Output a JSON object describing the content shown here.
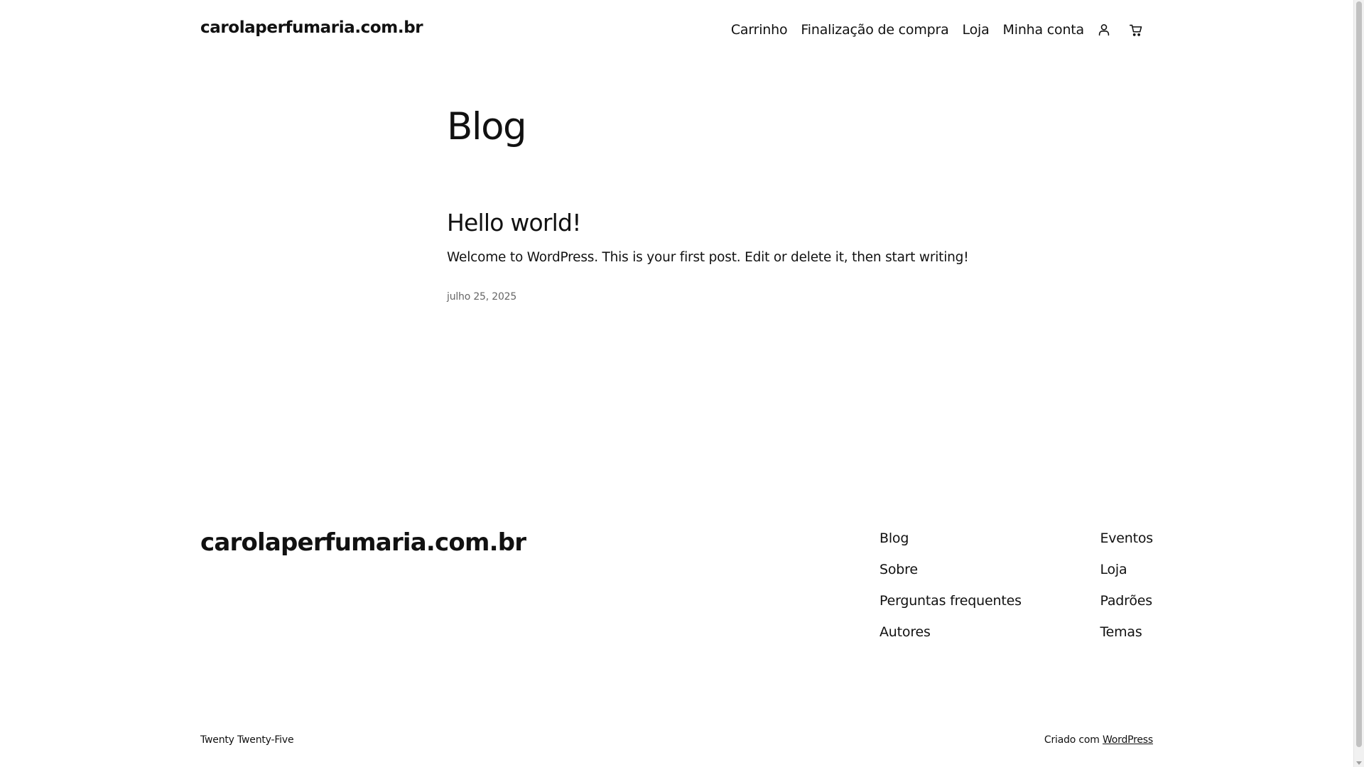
{
  "header": {
    "site_title": "carolaperfumaria.com.br",
    "nav": {
      "cart": "Carrinho",
      "checkout": "Finalização de compra",
      "shop": "Loja",
      "account": "Minha conta"
    },
    "icons": [
      "account-icon",
      "cart-icon"
    ]
  },
  "main": {
    "heading": "Blog",
    "post": {
      "title": "Hello world!",
      "excerpt": "Welcome to WordPress. This is your first post. Edit or delete it, then start writing!",
      "date": "julho 25, 2025"
    }
  },
  "footer": {
    "site_title": "carolaperfumaria.com.br",
    "column_1": [
      "Blog",
      "Sobre",
      "Perguntas frequentes",
      "Autores"
    ],
    "column_2": [
      "Eventos",
      "Loja",
      "Padrões",
      "Temas"
    ],
    "theme_name": "Twenty Twenty-Five",
    "credit_prefix": "Criado com",
    "credit_link": "WordPress"
  },
  "colors": {
    "text": "#111111",
    "muted": "#666666",
    "background": "#ffffff"
  }
}
